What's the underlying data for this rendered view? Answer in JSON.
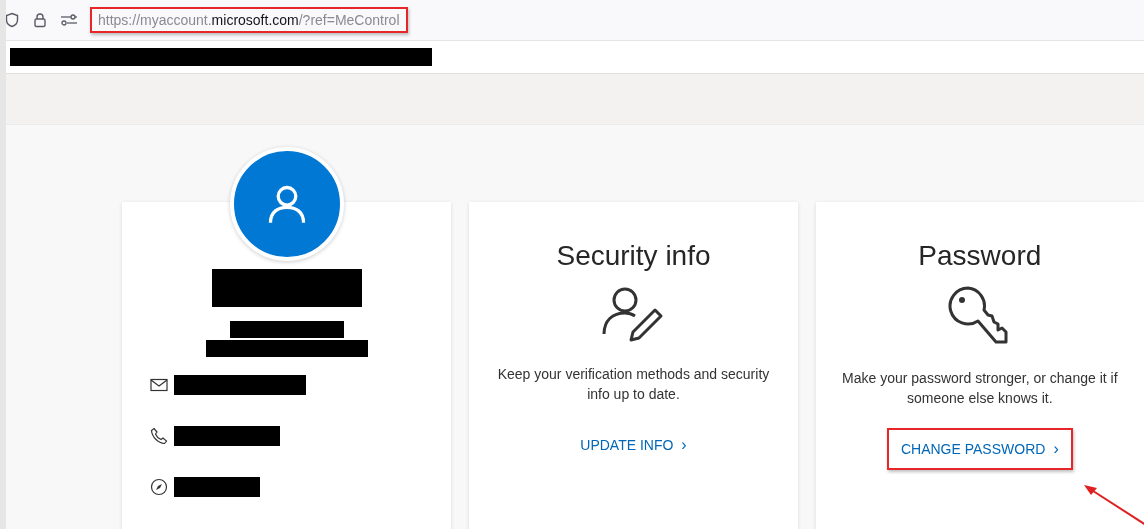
{
  "address_bar": {
    "url": "https://myaccount.**microsoft.com**/?ref=MeControl",
    "highlighted": true
  },
  "bookmarks_bar": {
    "redacted": true
  },
  "profile": {
    "name_redacted": true,
    "subtitle_redactions": [
      {
        "kind": "short"
      },
      {
        "kind": "long"
      }
    ],
    "details": [
      {
        "kind": "email"
      },
      {
        "kind": "phone"
      },
      {
        "kind": "location"
      }
    ]
  },
  "cards": [
    {
      "kind": "security",
      "title": "Security info",
      "description": "Keep your verification methods and security info up to date.",
      "action": "UPDATE INFO",
      "chevron": "›",
      "highlighted": false
    },
    {
      "kind": "password",
      "title": "Password",
      "description": "Make your password stronger, or change it if someone else knows it.",
      "action": "CHANGE PASSWORD",
      "chevron": "›",
      "highlighted": true
    }
  ],
  "annotation_arrow": true
}
